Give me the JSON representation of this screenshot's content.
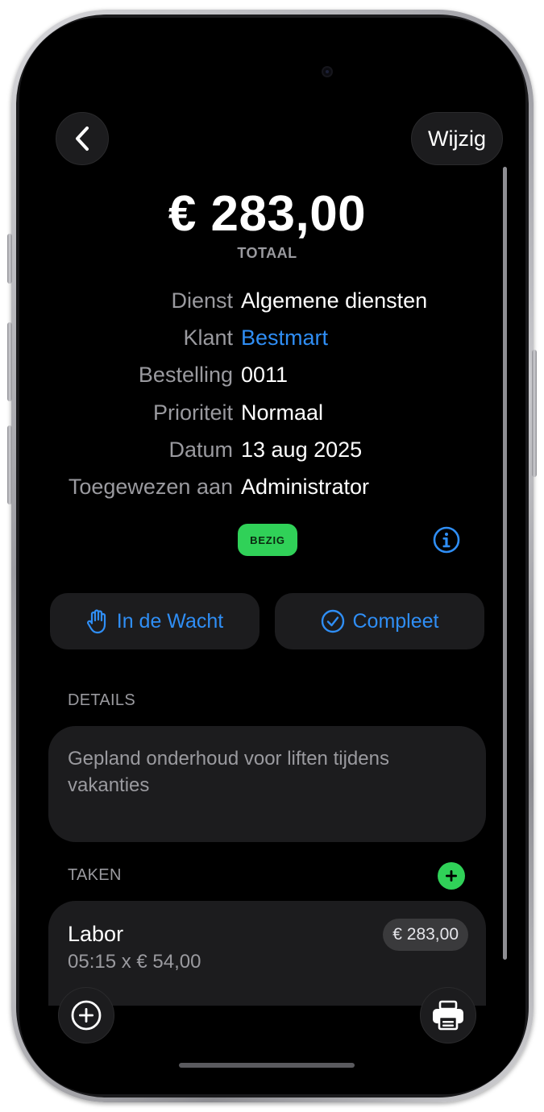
{
  "header": {
    "back_icon": "chevron-left-icon",
    "edit_label": "Wijzig"
  },
  "summary": {
    "total": "€ 283,00",
    "total_label": "TOTAAL"
  },
  "info": {
    "service_label": "Dienst",
    "service_value": "Algemene diensten",
    "client_label": "Klant",
    "client_value": "Bestmart",
    "order_label": "Bestelling",
    "order_value": "0011",
    "priority_label": "Prioriteit",
    "priority_value": "Normaal",
    "date_label": "Datum",
    "date_value": "13 aug 2025",
    "assigned_label": "Toegewezen aan",
    "assigned_value": "Administrator"
  },
  "status": {
    "badge": "BEZIG",
    "badge_color": "#30d158",
    "info_icon": "info-circle-icon"
  },
  "actions": {
    "hold_label": "In de Wacht",
    "hold_icon": "hand-raised-icon",
    "complete_label": "Compleet",
    "complete_icon": "checkmark-circle-icon"
  },
  "details": {
    "header": "DETAILS",
    "text": "Gepland onderhoud voor liften tijdens vakanties"
  },
  "tasks": {
    "header": "TAKEN",
    "add_icon": "plus-circle-icon",
    "items": [
      {
        "title": "Labor",
        "subtitle": "05:15 x € 54,00",
        "price": "€ 283,00"
      }
    ]
  },
  "toolbar": {
    "add_icon": "plus-circle-icon",
    "print_icon": "printer-icon"
  },
  "colors": {
    "accent": "#2f8ef5",
    "background": "#000000",
    "card": "#1c1c1e",
    "success": "#30d158"
  }
}
